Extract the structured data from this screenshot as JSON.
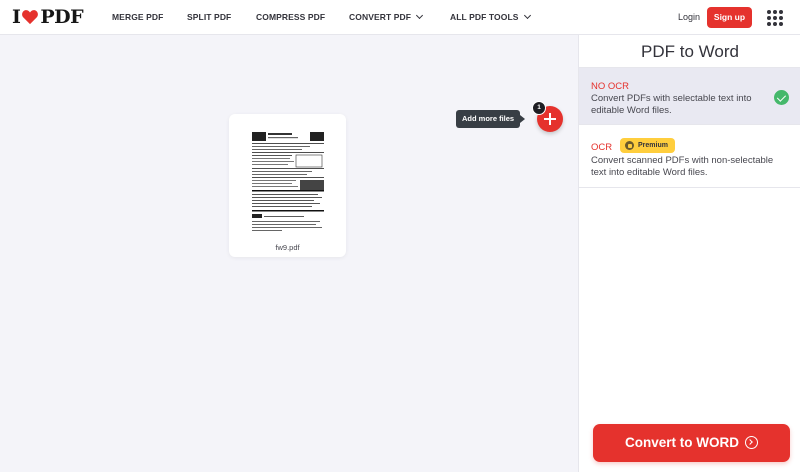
{
  "header": {
    "logo_left": "I",
    "logo_right": "PDF",
    "nav": [
      {
        "label": "MERGE PDF",
        "has_dropdown": false
      },
      {
        "label": "SPLIT PDF",
        "has_dropdown": false
      },
      {
        "label": "COMPRESS PDF",
        "has_dropdown": false
      },
      {
        "label": "CONVERT PDF",
        "has_dropdown": true
      },
      {
        "label": "ALL PDF TOOLS",
        "has_dropdown": true
      }
    ],
    "login_label": "Login",
    "signup_label": "Sign up",
    "apps_icon": "grid-icon"
  },
  "workarea": {
    "add_tooltip": "Add more files",
    "file_count": "1",
    "files": [
      {
        "name": "fw9.pdf"
      }
    ]
  },
  "sidebar": {
    "title": "PDF to Word",
    "options": [
      {
        "title": "NO OCR",
        "description": "Convert PDFs with selectable text into editable Word files.",
        "selected": true
      },
      {
        "title": "OCR",
        "badge": "Premium",
        "description": "Convert scanned PDFs with non-selectable text into editable Word files.",
        "selected": false
      }
    ],
    "convert_label": "Convert to WORD"
  },
  "colors": {
    "brand_red": "#e5322d",
    "selected_bg": "#e9e9f2",
    "check_green": "#45b86b",
    "premium_yellow": "#ffce3d"
  }
}
